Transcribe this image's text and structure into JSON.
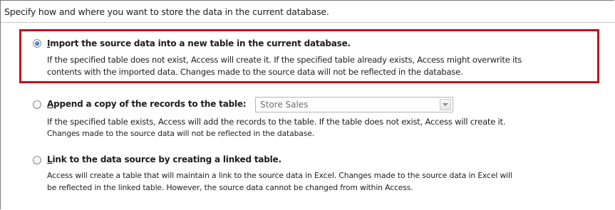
{
  "heading": "Specify how and where you want to store the data in the current database.",
  "options": [
    {
      "key": "I",
      "label_rest": "mport the source data into a new table in the current database.",
      "selected": true,
      "description": [
        "If the specified table does not exist, Access will create it. If the specified table already exists, Access might overwrite its",
        "contents with the imported data. Changes made to the source data will not be reflected in the database."
      ]
    },
    {
      "key": "A",
      "label_rest": "ppend a copy of the records to the table:",
      "selected": false,
      "table_select": {
        "value": "Store Sales",
        "enabled": false
      },
      "description": [
        "If the specified table exists, Access will add the records to the table. If the table does not exist, Access will create it.",
        "Changes made to the source data will not be reflected in the database."
      ]
    },
    {
      "key": "L",
      "label_rest": "ink to the data source by creating a linked table.",
      "selected": false,
      "description": [
        "Access will create a table that will maintain a link to the source data in Excel. Changes made to the source data in Excel will",
        "be reflected in the linked table. However, the source data cannot be changed from within Access."
      ]
    }
  ],
  "colors": {
    "highlight_border": "#c0111b",
    "radio_selected": "#1f6fc4",
    "disabled_text": "#6d6d6d"
  },
  "icons": [
    "radio-selected",
    "radio-unselected",
    "dropdown-arrow"
  ]
}
